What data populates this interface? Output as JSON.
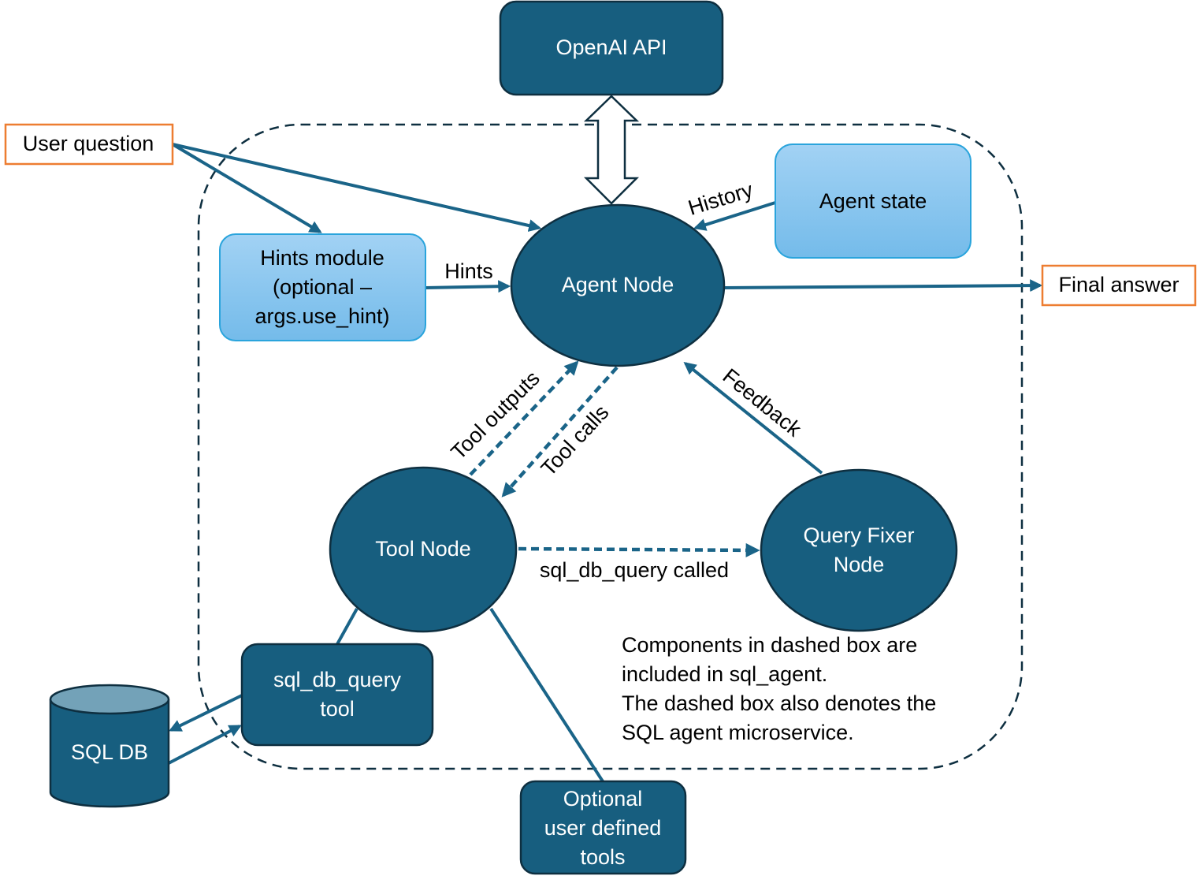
{
  "colors": {
    "node": "#175E7F",
    "node_border": "#0E2F40",
    "light_box": "#8CC8F0",
    "light_border": "#2AA4DC",
    "io_border": "#ED7D31",
    "arrow": "#1A6488"
  },
  "nodes": {
    "openai": "OpenAI API",
    "user_question": "User question",
    "final_answer": "Final answer",
    "hints_module": [
      "Hints module",
      "(optional –",
      "args.use_hint)"
    ],
    "agent_node": "Agent Node",
    "agent_state": "Agent state",
    "tool_node": "Tool Node",
    "query_fixer": [
      "Query Fixer",
      "Node"
    ],
    "sql_tool": [
      "sql_db_query",
      "tool"
    ],
    "sql_db": "SQL DB",
    "optional_tools": [
      "Optional",
      "user defined",
      "tools"
    ]
  },
  "edge_labels": {
    "hints": "Hints",
    "history": "History",
    "feedback": "Feedback",
    "tool_outputs": "Tool outputs",
    "tool_calls": "Tool calls",
    "query_called": "sql_db_query called"
  },
  "note": [
    "Components in dashed box are",
    "included in sql_agent.",
    "The dashed box also denotes the",
    "SQL agent microservice."
  ]
}
